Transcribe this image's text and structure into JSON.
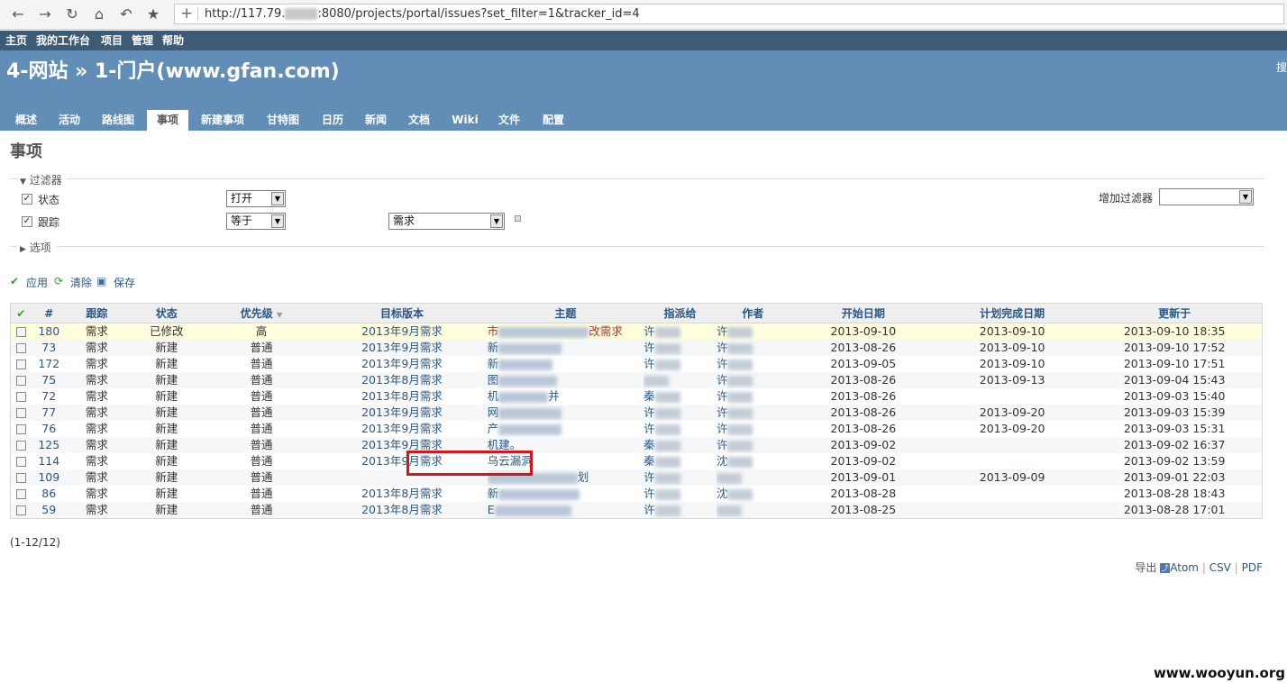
{
  "browser": {
    "url_prefix": "http://117.79.",
    "url_suffix": ":8080/projects/portal/issues?set_filter=1&tracker_id=4"
  },
  "top_menu": [
    "主页",
    "我的工作台",
    "项目",
    "管理",
    "帮助"
  ],
  "header": {
    "title": "4-网站 » 1-门户(www.gfan.com)",
    "search_stub": "搜"
  },
  "tabs": [
    "概述",
    "活动",
    "路线图",
    "事项",
    "新建事项",
    "甘特图",
    "日历",
    "新闻",
    "文档",
    "Wiki",
    "文件",
    "配置"
  ],
  "selected_tab": "事项",
  "page_title": "事项",
  "filters": {
    "legend": "过滤器",
    "status_label": "状态",
    "status_op": "打开",
    "tracker_label": "跟踪",
    "tracker_op": "等于",
    "tracker_value": "需求",
    "add_filter_label": "增加过滤器",
    "add_filter_value": ""
  },
  "options_legend": "选项",
  "actions": {
    "apply": "应用",
    "clear": "清除",
    "save": "保存"
  },
  "table": {
    "headers": [
      "#",
      "跟踪",
      "状态",
      "优先级",
      "目标版本",
      "主题",
      "指派给",
      "作者",
      "开始日期",
      "计划完成日期",
      "更新于"
    ],
    "rows": [
      {
        "id": "180",
        "tracker": "需求",
        "status": "已修改",
        "priority": "高",
        "version": "2013年9月需求",
        "subj_pre": "市",
        "subj_post": "改需求",
        "assignee": "许",
        "author": "许",
        "start": "2013-09-10",
        "due": "2013-09-10",
        "updated": "2013-09-10 18:35"
      },
      {
        "id": "73",
        "tracker": "需求",
        "status": "新建",
        "priority": "普通",
        "version": "2013年9月需求",
        "subj_pre": "新",
        "subj_post": "",
        "assignee": "许",
        "author": "许",
        "start": "2013-08-26",
        "due": "2013-09-10",
        "updated": "2013-09-10 17:52"
      },
      {
        "id": "172",
        "tracker": "需求",
        "status": "新建",
        "priority": "普通",
        "version": "2013年9月需求",
        "subj_pre": "新",
        "subj_post": "",
        "assignee": "许",
        "author": "许",
        "start": "2013-09-05",
        "due": "2013-09-10",
        "updated": "2013-09-10 17:51"
      },
      {
        "id": "75",
        "tracker": "需求",
        "status": "新建",
        "priority": "普通",
        "version": "2013年8月需求",
        "subj_pre": "图",
        "subj_post": "",
        "assignee": "",
        "author": "许",
        "start": "2013-08-26",
        "due": "2013-09-13",
        "updated": "2013-09-04 15:43"
      },
      {
        "id": "72",
        "tracker": "需求",
        "status": "新建",
        "priority": "普通",
        "version": "2013年8月需求",
        "subj_pre": "机",
        "subj_post": "并",
        "assignee": "秦",
        "author": "许",
        "start": "2013-08-26",
        "due": "",
        "updated": "2013-09-03 15:40"
      },
      {
        "id": "77",
        "tracker": "需求",
        "status": "新建",
        "priority": "普通",
        "version": "2013年9月需求",
        "subj_pre": "网",
        "subj_post": "",
        "assignee": "许",
        "author": "许",
        "start": "2013-08-26",
        "due": "2013-09-20",
        "updated": "2013-09-03 15:39"
      },
      {
        "id": "76",
        "tracker": "需求",
        "status": "新建",
        "priority": "普通",
        "version": "2013年9月需求",
        "subj_pre": "产",
        "subj_post": "",
        "assignee": "许",
        "author": "许",
        "start": "2013-08-26",
        "due": "2013-09-20",
        "updated": "2013-09-03 15:31"
      },
      {
        "id": "125",
        "tracker": "需求",
        "status": "新建",
        "priority": "普通",
        "version": "2013年9月需求",
        "subj_pre": "机",
        "subj_post": "建。",
        "assignee": "秦",
        "author": "许",
        "start": "2013-09-02",
        "due": "",
        "updated": "2013-09-02 16:37"
      },
      {
        "id": "114",
        "tracker": "需求",
        "status": "新建",
        "priority": "普通",
        "version": "2013年9月需求",
        "subj_pre": "乌云漏洞",
        "subj_post": "",
        "assignee": "秦",
        "author": "沈",
        "start": "2013-09-02",
        "due": "",
        "updated": "2013-09-02 13:59"
      },
      {
        "id": "109",
        "tracker": "需求",
        "status": "新建",
        "priority": "普通",
        "version": "",
        "subj_pre": "",
        "subj_post": "划",
        "assignee": "许",
        "author": "",
        "start": "2013-09-01",
        "due": "2013-09-09",
        "updated": "2013-09-01 22:03"
      },
      {
        "id": "86",
        "tracker": "需求",
        "status": "新建",
        "priority": "普通",
        "version": "2013年8月需求",
        "subj_pre": "新",
        "subj_post": "",
        "assignee": "许",
        "author": "沈",
        "start": "2013-08-28",
        "due": "",
        "updated": "2013-08-28 18:43"
      },
      {
        "id": "59",
        "tracker": "需求",
        "status": "新建",
        "priority": "普通",
        "version": "2013年8月需求",
        "subj_pre": "E",
        "subj_post": "",
        "assignee": "许",
        "author": "",
        "start": "2013-08-25",
        "due": "",
        "updated": "2013-08-28 17:01"
      }
    ]
  },
  "pager": "(1-12/12)",
  "export": {
    "label": "导出",
    "atom": "Atom",
    "csv": "CSV",
    "pdf": "PDF",
    "sep": "|"
  },
  "watermark": "www.wooyun.org"
}
